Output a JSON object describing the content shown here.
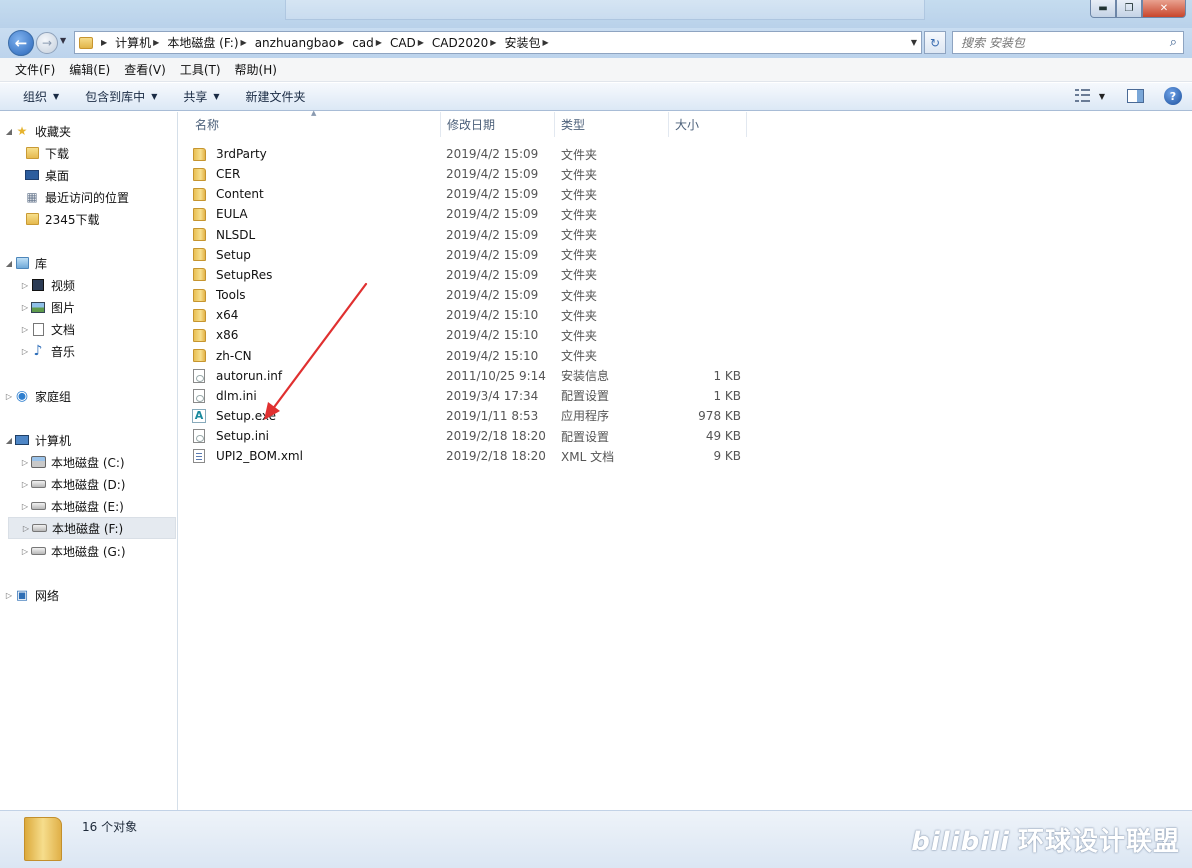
{
  "address": {
    "crumbs": [
      "计算机",
      "本地磁盘 (F:)",
      "anzhuangbao",
      "cad",
      "CAD",
      "CAD2020",
      "安装包"
    ]
  },
  "search": {
    "placeholder": "搜索 安装包"
  },
  "menu": [
    "文件(F)",
    "编辑(E)",
    "查看(V)",
    "工具(T)",
    "帮助(H)"
  ],
  "toolbar": {
    "organize": "组织",
    "include_library": "包含到库中",
    "share": "共享",
    "new_folder": "新建文件夹"
  },
  "nav": {
    "favorites": "收藏夹",
    "downloads": "下载",
    "desktop": "桌面",
    "recent": "最近访问的位置",
    "download2345": "2345下载",
    "libraries": "库",
    "videos": "视频",
    "pictures": "图片",
    "documents": "文档",
    "music": "音乐",
    "homegroup": "家庭组",
    "computer": "计算机",
    "drive_c": "本地磁盘 (C:)",
    "drive_d": "本地磁盘 (D:)",
    "drive_e": "本地磁盘 (E:)",
    "drive_f": "本地磁盘 (F:)",
    "drive_g": "本地磁盘 (G:)",
    "network": "网络"
  },
  "columns": {
    "name": "名称",
    "modified": "修改日期",
    "type": "类型",
    "size": "大小"
  },
  "files": [
    {
      "name": "3rdParty",
      "date": "2019/4/2 15:09",
      "type": "文件夹",
      "size": "",
      "icon": "folder-icon"
    },
    {
      "name": "CER",
      "date": "2019/4/2 15:09",
      "type": "文件夹",
      "size": "",
      "icon": "folder-icon"
    },
    {
      "name": "Content",
      "date": "2019/4/2 15:09",
      "type": "文件夹",
      "size": "",
      "icon": "folder-icon"
    },
    {
      "name": "EULA",
      "date": "2019/4/2 15:09",
      "type": "文件夹",
      "size": "",
      "icon": "folder-icon"
    },
    {
      "name": "NLSDL",
      "date": "2019/4/2 15:09",
      "type": "文件夹",
      "size": "",
      "icon": "folder-icon"
    },
    {
      "name": "Setup",
      "date": "2019/4/2 15:09",
      "type": "文件夹",
      "size": "",
      "icon": "folder-icon"
    },
    {
      "name": "SetupRes",
      "date": "2019/4/2 15:09",
      "type": "文件夹",
      "size": "",
      "icon": "folder-icon"
    },
    {
      "name": "Tools",
      "date": "2019/4/2 15:09",
      "type": "文件夹",
      "size": "",
      "icon": "folder-icon"
    },
    {
      "name": "x64",
      "date": "2019/4/2 15:10",
      "type": "文件夹",
      "size": "",
      "icon": "folder-icon"
    },
    {
      "name": "x86",
      "date": "2019/4/2 15:10",
      "type": "文件夹",
      "size": "",
      "icon": "folder-icon"
    },
    {
      "name": "zh-CN",
      "date": "2019/4/2 15:10",
      "type": "文件夹",
      "size": "",
      "icon": "folder-icon"
    },
    {
      "name": "autorun.inf",
      "date": "2011/10/25 9:14",
      "type": "安装信息",
      "size": "1 KB",
      "icon": "settings-file-icon"
    },
    {
      "name": "dlm.ini",
      "date": "2019/3/4 17:34",
      "type": "配置设置",
      "size": "1 KB",
      "icon": "settings-file-icon"
    },
    {
      "name": "Setup.exe",
      "date": "2019/1/11 8:53",
      "type": "应用程序",
      "size": "978 KB",
      "icon": "autodesk-app-icon"
    },
    {
      "name": "Setup.ini",
      "date": "2019/2/18 18:20",
      "type": "配置设置",
      "size": "49 KB",
      "icon": "settings-file-icon"
    },
    {
      "name": "UPI2_BOM.xml",
      "date": "2019/2/18 18:20",
      "type": "XML 文档",
      "size": "9 KB",
      "icon": "xml-file-icon"
    }
  ],
  "status": {
    "count": "16 个对象"
  },
  "watermark": {
    "logo": "bilibili",
    "text": "环球设计联盟"
  },
  "colors": {
    "annotation_arrow": "#e03030",
    "chrome": "#c5dcef"
  }
}
